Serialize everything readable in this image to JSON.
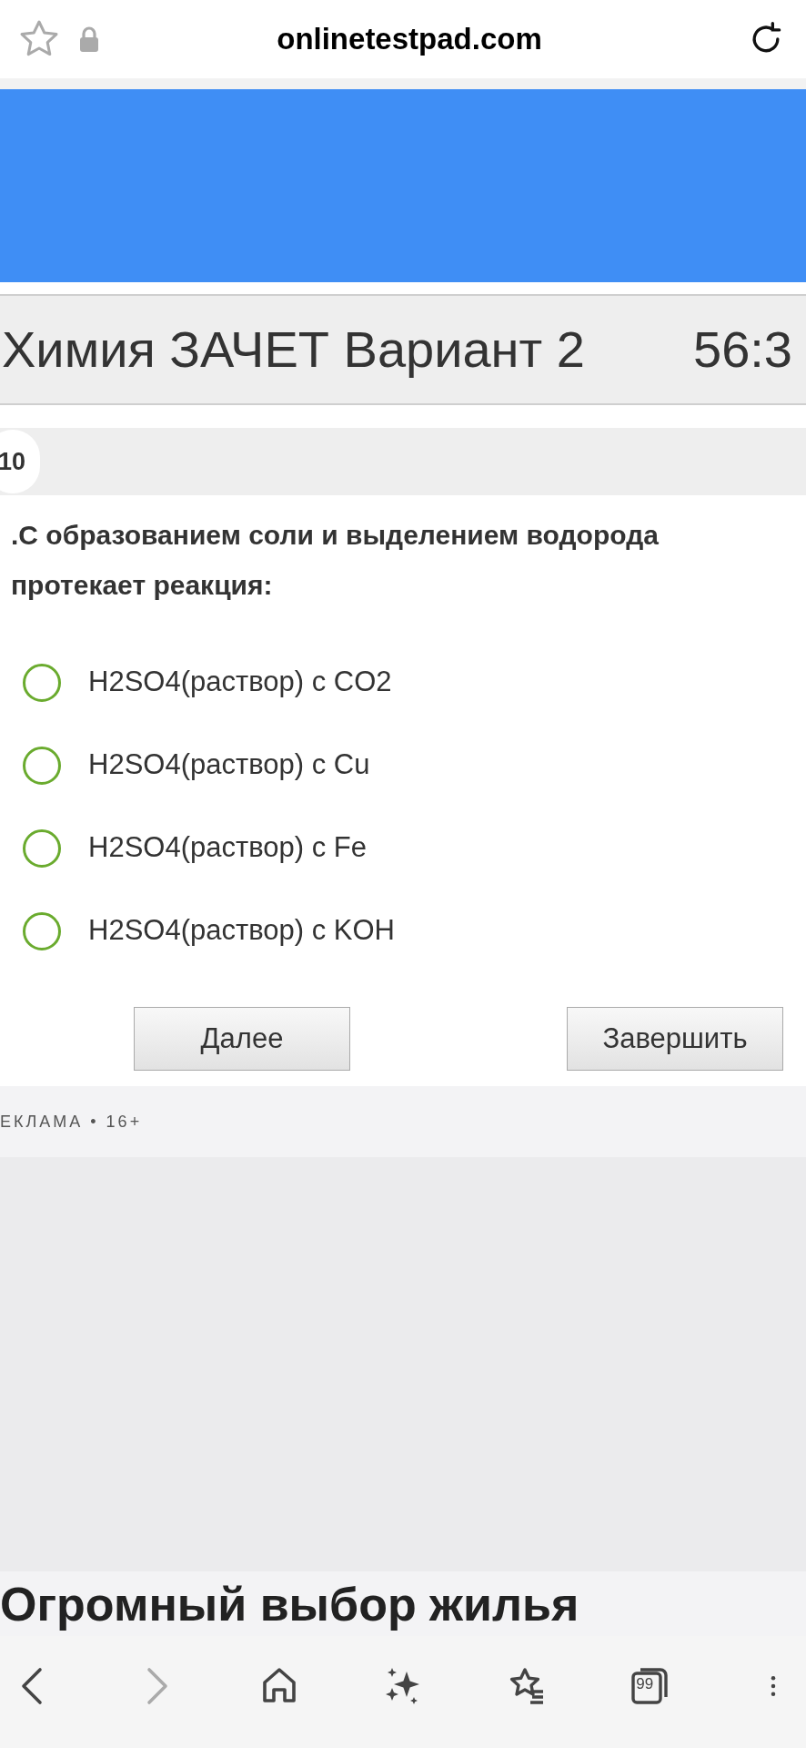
{
  "browser": {
    "url": "onlinetestpad.com"
  },
  "test": {
    "title": "Химия ЗАЧЕТ Вариант 2",
    "timer": "56:3"
  },
  "question": {
    "number": "10",
    "text": ".С образованием соли и выделением водорода протекает реакция:",
    "options": [
      {
        "label": "H2SO4(раствор) с CO2",
        "selected": false
      },
      {
        "label": "H2SO4(раствор) с Cu",
        "selected": false
      },
      {
        "label": "H2SO4(раствор) с Fe",
        "selected": false
      },
      {
        "label": "H2SO4(раствор) с KOH",
        "selected": false
      }
    ]
  },
  "buttons": [
    "Далее",
    "Завершить"
  ],
  "ad": {
    "label": "ЕКЛАМА • 16+",
    "headline": "Огромный выбор жилья"
  },
  "nav": [
    {
      "kind": "back",
      "disabled": false
    },
    {
      "kind": "forward",
      "disabled": true
    },
    {
      "kind": "home"
    },
    {
      "kind": "ai"
    },
    {
      "kind": "bookmarks"
    },
    {
      "kind": "tabs",
      "count": "99"
    },
    {
      "kind": "menu"
    }
  ]
}
